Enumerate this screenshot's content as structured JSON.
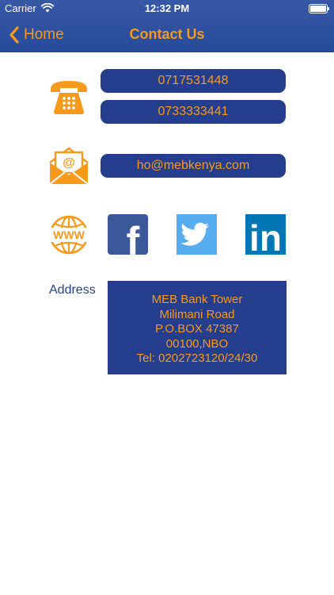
{
  "status_bar": {
    "carrier": "Carrier",
    "time": "12:32 PM"
  },
  "nav": {
    "back_label": "Home",
    "title": "Contact Us"
  },
  "contact": {
    "phones": [
      "0717531448",
      "0733333441"
    ],
    "email": "ho@mebkenya.com",
    "email_icon_glyph": "@",
    "web_icon_text": "WWW"
  },
  "social": {
    "facebook_glyph": "f",
    "linkedin_glyph": "in"
  },
  "address": {
    "label": "Address",
    "lines": [
      "MEB Bank Tower",
      "Milimani Road",
      "P.O.BOX 47387",
      "00100,NBO",
      "Tel: 0202723120/24/30"
    ]
  },
  "colors": {
    "navy": "#243e8d",
    "orange": "#f79a1c",
    "facebook": "#3b5998",
    "twitter": "#55acee",
    "linkedin": "#0077b5"
  }
}
